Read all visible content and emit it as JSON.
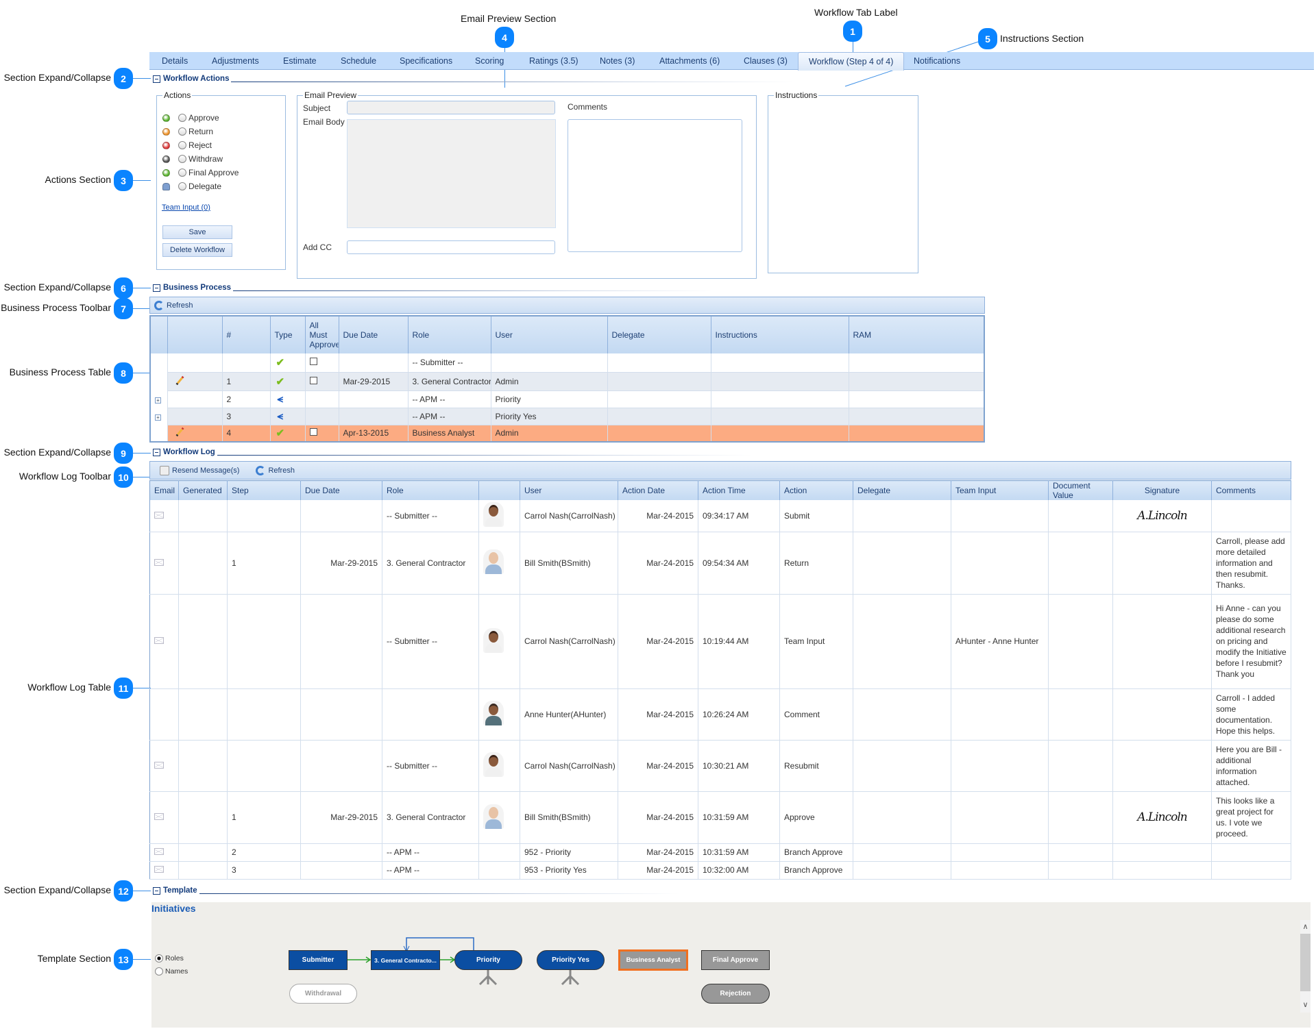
{
  "callouts": [
    {
      "num": "1",
      "label": "Workflow Tab Label"
    },
    {
      "num": "2",
      "label": "Section Expand/Collapse"
    },
    {
      "num": "3",
      "label": "Actions Section"
    },
    {
      "num": "4",
      "label": "Email Preview Section"
    },
    {
      "num": "5",
      "label": "Instructions Section"
    },
    {
      "num": "6",
      "label": "Section Expand/Collapse"
    },
    {
      "num": "7",
      "label": "Business Process Toolbar"
    },
    {
      "num": "8",
      "label": "Business Process Table"
    },
    {
      "num": "9",
      "label": "Section Expand/Collapse"
    },
    {
      "num": "10",
      "label": "Workflow Log Toolbar"
    },
    {
      "num": "11",
      "label": "Workflow Log Table"
    },
    {
      "num": "12",
      "label": "Section Expand/Collapse"
    },
    {
      "num": "13",
      "label": "Template Section"
    }
  ],
  "tabs": [
    "Details",
    "Adjustments",
    "Estimate",
    "Schedule",
    "Specifications",
    "Scoring",
    "Ratings (3.5)",
    "Notes (3)",
    "Attachments (6)",
    "Clauses (3)",
    "Workflow (Step 4 of 4)",
    "Notifications"
  ],
  "active_tab": "Workflow (Step 4 of 4)",
  "workflow_actions": {
    "title": "Workflow Actions",
    "actions_legend": "Actions",
    "actions": [
      {
        "label": "Approve",
        "color": "#5cb531"
      },
      {
        "label": "Return",
        "color": "#f0952c"
      },
      {
        "label": "Reject",
        "color": "#e0393a"
      },
      {
        "label": "Withdraw",
        "color": "#555555"
      },
      {
        "label": "Final Approve",
        "color": "#5cb531"
      },
      {
        "label": "Delegate",
        "icon": "user-icon"
      }
    ],
    "team_input": "Team Input (0)",
    "save": "Save",
    "delete": "Delete Workflow",
    "email_legend": "Email Preview",
    "subject_label": "Subject",
    "subject_value": "",
    "body_label": "Email Body",
    "body_value": "",
    "add_cc_label": "Add CC",
    "add_cc_value": "",
    "comments_label": "Comments",
    "comments_value": "",
    "instructions_legend": "Instructions"
  },
  "business_process": {
    "title": "Business Process",
    "refresh": "Refresh",
    "columns": [
      "",
      "#",
      "Type",
      "All Must Approve",
      "Due Date",
      "Role",
      "User",
      "Delegate",
      "Instructions",
      "RAM"
    ],
    "rows": [
      {
        "expand": false,
        "edit": false,
        "num": "",
        "type": "check",
        "all_must": true,
        "due": "",
        "role": "-- Submitter --",
        "user": "",
        "style": ""
      },
      {
        "expand": false,
        "edit": true,
        "num": "1",
        "type": "check",
        "all_must": true,
        "due": "Mar-29-2015",
        "role": "3. General Contractor",
        "user": "Admin",
        "style": "alt"
      },
      {
        "expand": true,
        "edit": false,
        "num": "2",
        "type": "branch",
        "all_must": false,
        "due": "",
        "role": "-- APM --",
        "user": "Priority",
        "style": ""
      },
      {
        "expand": true,
        "edit": false,
        "num": "3",
        "type": "branch",
        "all_must": false,
        "due": "",
        "role": "-- APM --",
        "user": "Priority Yes",
        "style": "alt"
      },
      {
        "expand": false,
        "edit": true,
        "num": "4",
        "type": "check",
        "all_must": true,
        "due": "Apr-13-2015",
        "role": "Business Analyst",
        "user": "Admin",
        "style": "hl"
      }
    ],
    "highlight_color": "#fcab82"
  },
  "workflow_log": {
    "title": "Workflow Log",
    "resend": "Resend Message(s)",
    "refresh": "Refresh",
    "columns": [
      "Email",
      "Generated",
      "Step",
      "Due Date",
      "Role",
      "",
      "User",
      "Action Date",
      "Action Time",
      "Action",
      "Delegate",
      "Team Input",
      "Document Value",
      "Signature",
      "Comments"
    ],
    "rows": [
      {
        "email": true,
        "generated": "",
        "step": "",
        "due": "",
        "role": "-- Submitter --",
        "avatar": "carrol",
        "user": "Carrol Nash(CarrolNash)",
        "date": "Mar-24-2015",
        "time": "09:34:17 AM",
        "action": "Submit",
        "delegate": "",
        "team": "",
        "doc": "",
        "signature": "A.Lincoln",
        "comments": ""
      },
      {
        "email": true,
        "generated": "",
        "step": "1",
        "due": "Mar-29-2015",
        "role": "3. General Contractor",
        "avatar": "bill",
        "user": "Bill Smith(BSmith)",
        "date": "Mar-24-2015",
        "time": "09:54:34 AM",
        "action": "Return",
        "delegate": "",
        "team": "",
        "doc": "",
        "signature": "",
        "comments": "Carroll, please add more detailed information and then resubmit. Thanks."
      },
      {
        "email": true,
        "generated": "",
        "step": "",
        "due": "",
        "role": "-- Submitter --",
        "avatar": "carrol",
        "user": "Carrol Nash(CarrolNash)",
        "date": "Mar-24-2015",
        "time": "10:19:44 AM",
        "action": "Team Input",
        "delegate": "",
        "team": "AHunter - Anne Hunter",
        "doc": "",
        "signature": "",
        "comments": "Hi Anne - can you please do some additional research on pricing and modify the Initiative before I resubmit? Thank you"
      },
      {
        "email": false,
        "generated": "",
        "step": "",
        "due": "",
        "role": "",
        "avatar": "anne",
        "user": "Anne Hunter(AHunter)",
        "date": "Mar-24-2015",
        "time": "10:26:24 AM",
        "action": "Comment",
        "delegate": "",
        "team": "",
        "doc": "",
        "signature": "",
        "comments": "Carroll - I added some documentation. Hope this helps."
      },
      {
        "email": true,
        "generated": "",
        "step": "",
        "due": "",
        "role": "-- Submitter --",
        "avatar": "carrol",
        "user": "Carrol Nash(CarrolNash)",
        "date": "Mar-24-2015",
        "time": "10:30:21 AM",
        "action": "Resubmit",
        "delegate": "",
        "team": "",
        "doc": "",
        "signature": "",
        "comments": "Here you are Bill - additional information attached."
      },
      {
        "email": true,
        "generated": "",
        "step": "1",
        "due": "Mar-29-2015",
        "role": "3. General Contractor",
        "avatar": "bill",
        "user": "Bill Smith(BSmith)",
        "date": "Mar-24-2015",
        "time": "10:31:59 AM",
        "action": "Approve",
        "delegate": "",
        "team": "",
        "doc": "",
        "signature": "A.Lincoln",
        "comments": "This looks like a great project for us. I vote we proceed."
      },
      {
        "email": true,
        "generated": "",
        "step": "2",
        "due": "",
        "role": "-- APM --",
        "avatar": "",
        "user": "952 - Priority",
        "date": "Mar-24-2015",
        "time": "10:31:59 AM",
        "action": "Branch Approve",
        "delegate": "",
        "team": "",
        "doc": "",
        "signature": "",
        "comments": ""
      },
      {
        "email": true,
        "generated": "",
        "step": "3",
        "due": "",
        "role": "-- APM --",
        "avatar": "",
        "user": "953 - Priority Yes",
        "date": "Mar-24-2015",
        "time": "10:32:00 AM",
        "action": "Branch Approve",
        "delegate": "",
        "team": "",
        "doc": "",
        "signature": "",
        "comments": ""
      }
    ]
  },
  "template": {
    "title": "Template",
    "diagram_title": "Initiatives",
    "view_options": [
      {
        "label": "Roles",
        "selected": true
      },
      {
        "label": "Names",
        "selected": false
      }
    ],
    "nodes": {
      "submitter": "Submitter",
      "general_contractor": "3. General Contracto...",
      "priority": "Priority",
      "priority_yes": "Priority Yes",
      "business_analyst": "Business Analyst",
      "final_approve": "Final Approve",
      "withdrawal": "Withdrawal",
      "rejection": "Rejection"
    },
    "current_step_color": "#f07020"
  }
}
